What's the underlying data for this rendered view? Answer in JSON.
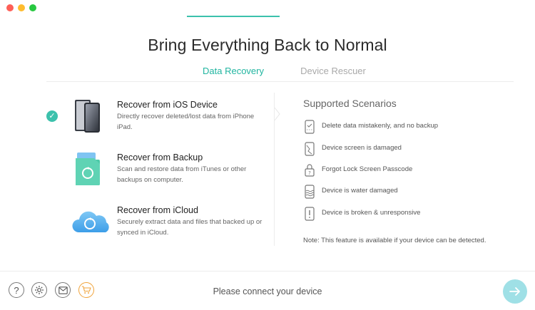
{
  "window": {
    "title": "Bring Everything Back to Normal"
  },
  "tabs": [
    {
      "label": "Data Recovery",
      "active": true
    },
    {
      "label": "Device Rescuer",
      "active": false
    }
  ],
  "options": [
    {
      "title": "Recover from iOS Device",
      "description": "Directly recover deleted/lost data from iPhone iPad.",
      "selected": true,
      "icon": "iphone-icon"
    },
    {
      "title": "Recover from Backup",
      "description": "Scan and restore data from iTunes or other backups on computer.",
      "selected": false,
      "icon": "backup-file-icon"
    },
    {
      "title": "Recover from iCloud",
      "description": "Securely extract data and files that backed up or synced in iCloud.",
      "selected": false,
      "icon": "icloud-icon"
    }
  ],
  "scenarios": {
    "title": "Supported Scenarios",
    "items": [
      {
        "text": "Delete data mistakenly, and no backup",
        "icon": "deleted-data-icon"
      },
      {
        "text": "Device screen is damaged",
        "icon": "cracked-screen-icon"
      },
      {
        "text": "Forgot Lock Screen Passcode",
        "icon": "lock-icon"
      },
      {
        "text": "Device is water damaged",
        "icon": "water-damage-icon"
      },
      {
        "text": "Device is broken & unresponsive",
        "icon": "broken-device-icon"
      }
    ],
    "note": "Note: This feature is available if your device can be detected."
  },
  "footer": {
    "status": "Please connect your device",
    "buttons": [
      {
        "icon": "help-icon"
      },
      {
        "icon": "settings-icon"
      },
      {
        "icon": "mail-icon"
      },
      {
        "icon": "cart-icon"
      }
    ],
    "next_icon": "arrow-right-icon"
  },
  "colors": {
    "accent": "#3cc1ac",
    "tab_active": "#21b5a0",
    "tab_inactive": "#a9a9a9",
    "next_button": "#9fe0e6",
    "cart": "#f0a33a"
  }
}
